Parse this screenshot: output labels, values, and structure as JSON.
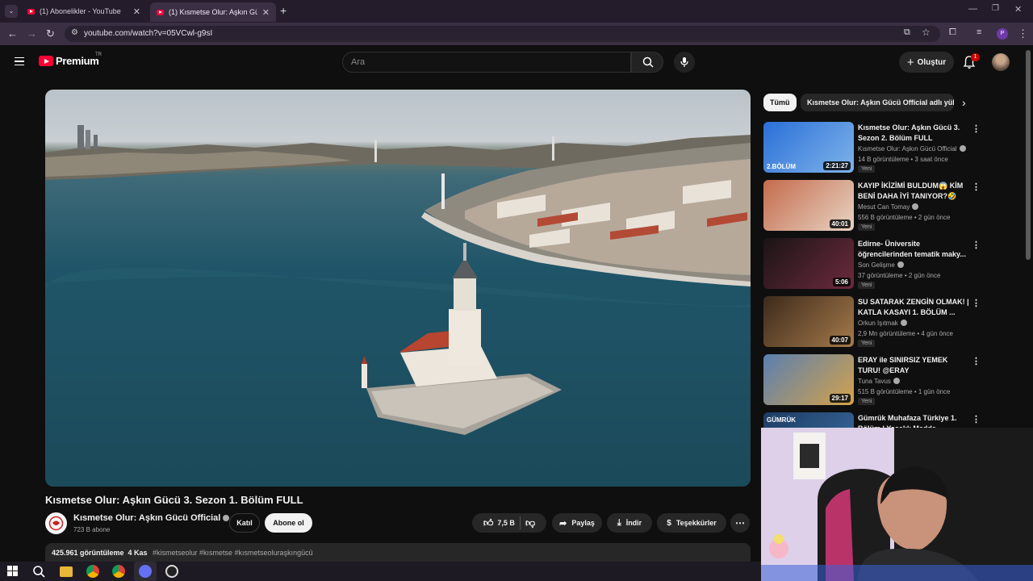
{
  "browser": {
    "tabs": [
      {
        "title": "(1) Abonelikler - YouTube",
        "active": false
      },
      {
        "title": "(1) Kısmetse Olur: Aşkın Gücü 3",
        "active": true
      }
    ],
    "url": "youtube.com/watch?v=05VCwl-g9sI"
  },
  "header": {
    "logo_text": "Premium",
    "region": "TR",
    "search_placeholder": "Ara",
    "create_label": "Oluştur",
    "notification_count": "1"
  },
  "video": {
    "title": "Kısmetse Olur: Aşkın Gücü 3. Sezon 1. Bölüm FULL",
    "channel": "Kısmetse Olur: Aşkın Gücü Official",
    "subscribers": "723 B abone",
    "join_label": "Katıl",
    "subscribe_label": "Abone ol",
    "likes": "7,5 B",
    "share_label": "Paylaş",
    "download_label": "İndir",
    "thanks_label": "Teşekkürler",
    "views_date": "425.961 görüntüleme  4 Kas",
    "hashtags": "#kismetseolur #kısmetse #kısmetseoluraşkıngücü"
  },
  "sidebar": {
    "chips": [
      "Tümü",
      "Kısmetse Olur: Aşkın Gücü Official adlı yük"
    ],
    "recommendations": [
      {
        "title": "Kısmetse Olur: Aşkın Gücü 3. Sezon 2. Bölüm FULL",
        "channel": "Kısmetse Olur: Aşkın Gücü Official",
        "meta": "14 B görüntüleme • 3 saat önce",
        "badge": "Yeni",
        "duration": "2:21:27",
        "thumb_label": "2.BÖLÜM",
        "colors": [
          "#2a6fd8",
          "#7fb4ea"
        ]
      },
      {
        "title": "KAYIP İKİZİMİ BULDUM😱 KİM BENİ DAHA İYİ TANIYOR?🤣",
        "channel": "Mesut Can Tomay",
        "meta": "556 B görüntüleme • 2 gün önce",
        "badge": "Yeni",
        "duration": "40:01",
        "thumb_label": "",
        "colors": [
          "#c46b4c",
          "#e8d4c4"
        ]
      },
      {
        "title": "Edirne- Üniversite öğrencilerinden tematik maky...",
        "channel": "Son Gelişme",
        "meta": "37 görüntüleme • 2 gün önce",
        "badge": "Yeni",
        "duration": "5:06",
        "thumb_label": "",
        "colors": [
          "#1a1414",
          "#6d2a3e"
        ]
      },
      {
        "title": "SU SATARAK ZENGİN OLMAK! | KATLA KASAYI 1. BÖLÜM ...",
        "channel": "Orkun Işıtmak",
        "meta": "2,9 Mn görüntüleme • 4 gün önce",
        "badge": "Yeni",
        "duration": "40:07",
        "thumb_label": "",
        "colors": [
          "#3d2a1c",
          "#a57a4a"
        ]
      },
      {
        "title": "ERAY ile SINIRSIZ YEMEK TURU! @ERAY",
        "channel": "Tuna Tavus",
        "meta": "515 B görüntüleme • 1 gün önce",
        "badge": "Yeni",
        "duration": "29:17",
        "thumb_label": "",
        "colors": [
          "#5a7fb0",
          "#d4a24a"
        ]
      },
      {
        "title": "Gümrük Muhafaza Türkiye 1. Bölüm | Yasaklı Madde",
        "channel": "",
        "meta": "",
        "badge": "",
        "duration": "",
        "thumb_label": "GÜMRÜK",
        "colors": [
          "#1d3c62",
          "#3a6aa0"
        ]
      }
    ]
  }
}
